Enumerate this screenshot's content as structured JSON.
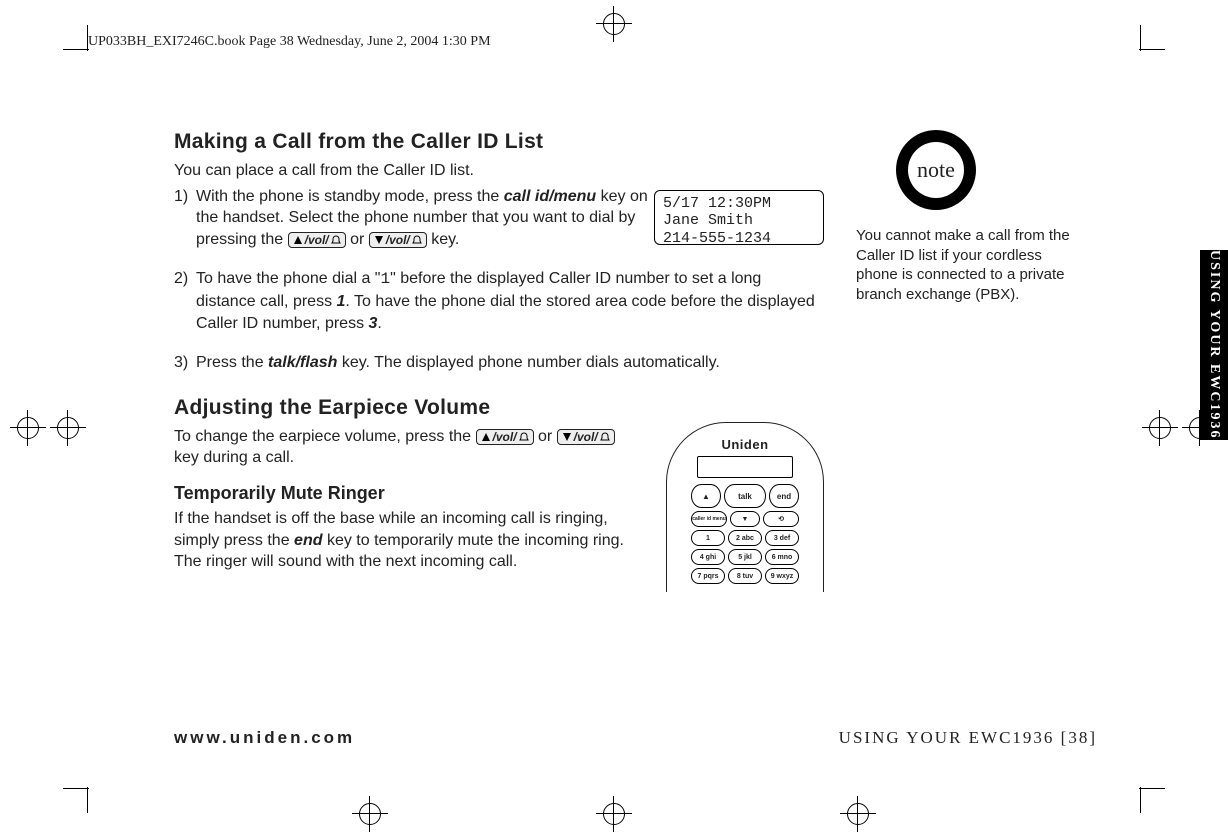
{
  "print_header": "UP033BH_EXI7246C.book  Page 38  Wednesday, June 2, 2004  1:30 PM",
  "section1": {
    "heading": "Making a Call from the Caller ID List",
    "intro": "You can place a call from the Caller ID list.",
    "step1_num": "1)",
    "step1_a": "With the phone is standby mode, press the ",
    "step1_key": "call id/menu",
    "step1_b": " key on the handset. Select the phone number that you want to dial by pressing the ",
    "vol_label": "/vol/",
    "step1_or": " or ",
    "step1_c": " key.",
    "step2_num": "2)",
    "step2_a": "To have the phone dial a \"",
    "step2_one": "1",
    "step2_b": "\" before the displayed Caller ID number to set a long distance call, press ",
    "step2_key1": "1",
    "step2_c": ". To have the phone dial the stored area code before the displayed Caller ID number, press ",
    "step2_key3": "3",
    "step2_d": ".",
    "step3_num": "3)",
    "step3_a": "Press the ",
    "step3_key": "talk/flash",
    "step3_b": " key. The displayed phone number dials automatically."
  },
  "lcd": {
    "line1": " 5/17 12:30PM",
    "line2": "Jane Smith",
    "line3": "214-555-1234"
  },
  "section2": {
    "heading": "Adjusting the Earpiece Volume",
    "body_a": "To change the earpiece volume, press the ",
    "body_or": " or ",
    "body_b": " key during a call."
  },
  "section3": {
    "heading": "Temporarily Mute Ringer",
    "body_a": "If the handset is off the base while an incoming call is ringing, simply press the ",
    "body_key": "end",
    "body_b": " key to temporarily mute the incoming ring. The ringer will sound with the next incoming call."
  },
  "handset": {
    "brand": "Uniden",
    "btn_vol_up": "▲",
    "btn_vol_dn": "▼",
    "btn_talk": "talk",
    "btn_end": "end",
    "btn_cid": "caller id menu",
    "btn_redial": "⟲",
    "k1": "1",
    "k2": "2 abc",
    "k3": "3 def",
    "k4": "4 ghi",
    "k5": "5 jkl",
    "k6": "6 mno",
    "k7": "7 pqrs",
    "k8": "8 tuv",
    "k9": "9 wxyz"
  },
  "note": {
    "badge": "note",
    "text": "You cannot make a call from the Caller ID list if your cordless phone is connected to a private branch exchange (PBX)."
  },
  "side_tab": "USING YOUR EWC1936",
  "footer_left": "www.uniden.com",
  "footer_right": "USING YOUR EWC1936 [38]"
}
